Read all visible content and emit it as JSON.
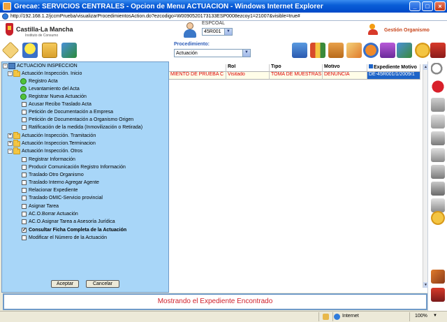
{
  "window": {
    "title": "Grecae: SERVICIOS CENTRALES - Opcion de Menu ACTUACION - Windows Internet Explorer",
    "min": "_",
    "max": "□",
    "close": "×"
  },
  "address": {
    "url": "http://192.168.1.2/jccmPrueba/visualizarProcedimientosAction.do?ezcodigo=W0090520173133ESP0008ezcoy1=21007&visible=true#"
  },
  "header": {
    "logo_title": "Castilla-La Mancha",
    "logo_sub": "Instituto de Consumo",
    "user_label": "ESPCOAL",
    "user_select": "45R001",
    "gestion": "Gestión Organismo"
  },
  "toolbar": {
    "procedimiento_label": "Procedimiento:",
    "procedimiento_value": "Actuación"
  },
  "tree": {
    "root": "ACTUACION INSPECCION",
    "groups": [
      {
        "label": "Actuación Inspección. Inicio",
        "items": [
          {
            "label": "Registro Acta",
            "icon": "green-check-icon"
          },
          {
            "label": "Levantamiento del Acta",
            "icon": "green-check-icon"
          },
          {
            "label": "Registrar Nueva Actuación",
            "icon": "green-check-icon"
          },
          {
            "label": "Acusar Recibo Traslado Acta",
            "checked": false
          },
          {
            "label": "Petición de Documentación a Empresa",
            "checked": false
          },
          {
            "label": "Petición de Documentación a Organismo Origen",
            "checked": false
          },
          {
            "label": "Ratificación de la medida (Inmovilización o Retirada)",
            "checked": false
          }
        ]
      },
      {
        "label": "Actuación Inspección. Tramitación"
      },
      {
        "label": "Actuación Inspeccion.Terminacion"
      },
      {
        "label": "Actuación Inspección. Otros",
        "items": [
          {
            "label": "Registrar Información",
            "checked": false
          },
          {
            "label": "Producir Comunicación Registro Información",
            "checked": false
          },
          {
            "label": "Traslado Otro Organismo",
            "checked": false
          },
          {
            "label": "Traslado Interno Agregar Agente",
            "checked": false
          },
          {
            "label": "Relacionar Expediente",
            "checked": false
          },
          {
            "label": "Traslado OMIC-Servicio provincial",
            "checked": false
          },
          {
            "label": "Asignar Tarea",
            "checked": false
          },
          {
            "label": "AC.O.Borrar Actuación",
            "checked": false
          },
          {
            "label": "AC.O.Asignar Tarea a Asesoría Jurídica",
            "checked": false
          },
          {
            "label": "Consultar Ficha Completa de la Actuación",
            "checked": true
          },
          {
            "label": "Modificar el Número de la Actuación",
            "checked": false
          }
        ]
      }
    ],
    "accept": "Aceptar",
    "cancel": "Cancelar"
  },
  "grid": {
    "columns": [
      "",
      "Rol",
      "Tipo",
      "Motivo",
      "Expediente Motivo"
    ],
    "rows": [
      [
        "MIENTO DE PRUEBA C",
        "Visitado",
        "TOMA DE MUESTRAS",
        "DENUNCIA",
        "DE-45R001/1/2009/1"
      ]
    ]
  },
  "message": "Mostrando el Expediente Encontrado",
  "statusbar": {
    "zone": "Internet",
    "zoom": "100%"
  }
}
